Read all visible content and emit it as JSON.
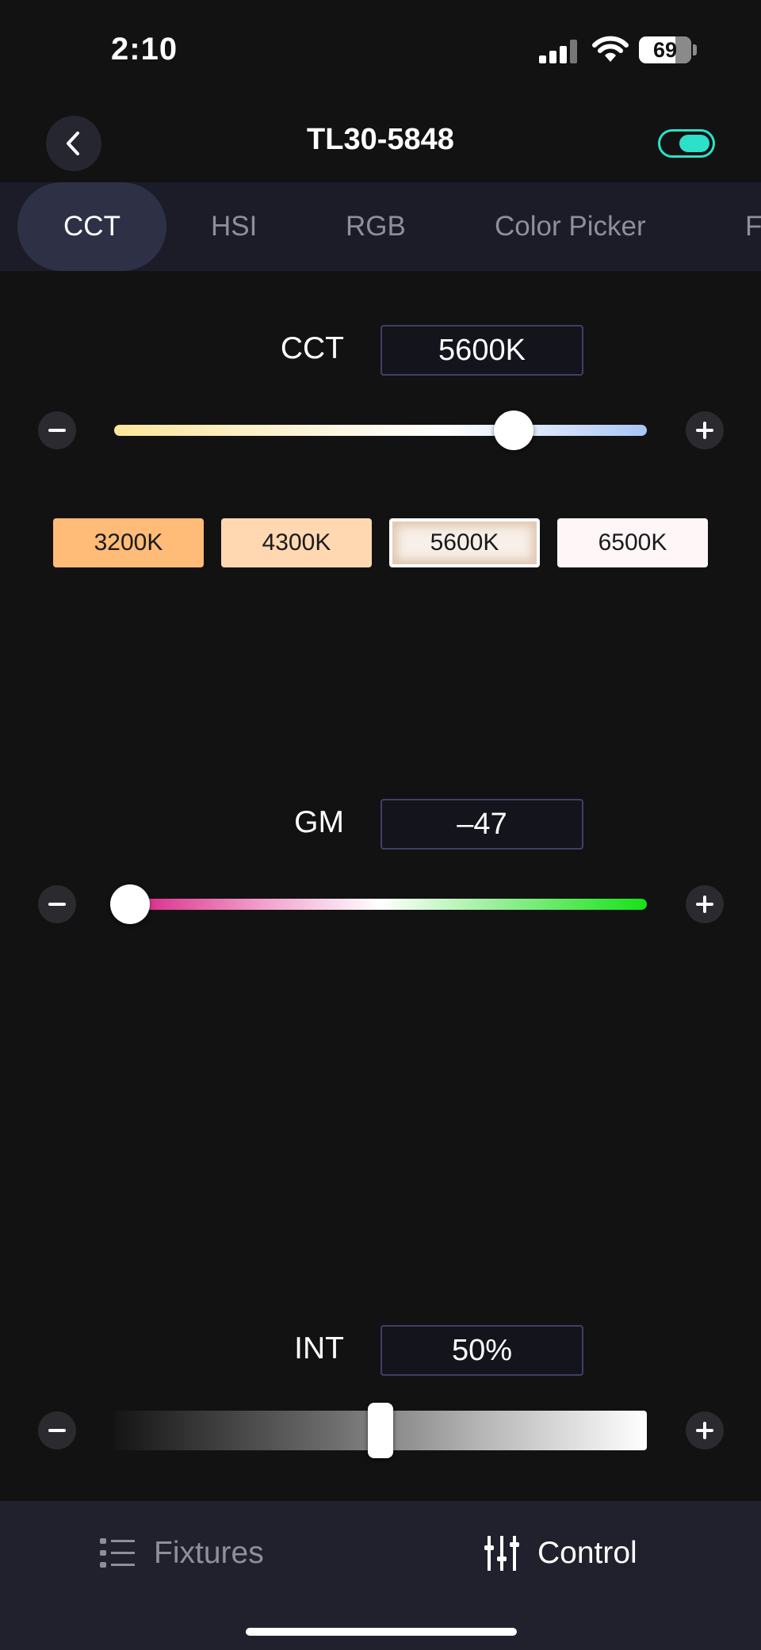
{
  "status": {
    "time": "2:10",
    "battery": "69"
  },
  "header": {
    "title": "TL30-5848",
    "power_on": true
  },
  "tabs": [
    {
      "label": "CCT",
      "active": true
    },
    {
      "label": "HSI",
      "active": false
    },
    {
      "label": "RGB",
      "active": false
    },
    {
      "label": "Color Picker",
      "active": false
    },
    {
      "label": "F",
      "active": false
    }
  ],
  "cct": {
    "label": "CCT",
    "value": "5600K",
    "level": 0.75
  },
  "presets": [
    {
      "label": "3200K",
      "color": "#ffbb78",
      "selected": false
    },
    {
      "label": "4300K",
      "color": "#ffd8b2",
      "selected": false
    },
    {
      "label": "5600K",
      "color": "#f7efe8",
      "selected": true
    },
    {
      "label": "6500K",
      "color": "#fff6f8",
      "selected": false
    }
  ],
  "gm": {
    "label": "GM",
    "value": "–47",
    "level": 0.03
  },
  "int": {
    "label": "INT",
    "value": "50%",
    "level": 0.5
  },
  "bottom_nav": {
    "fixtures": "Fixtures",
    "control": "Control"
  },
  "colors": {
    "accent": "#2de0c9",
    "tab_active": "#2e3146",
    "box_border": "#3e4068"
  }
}
